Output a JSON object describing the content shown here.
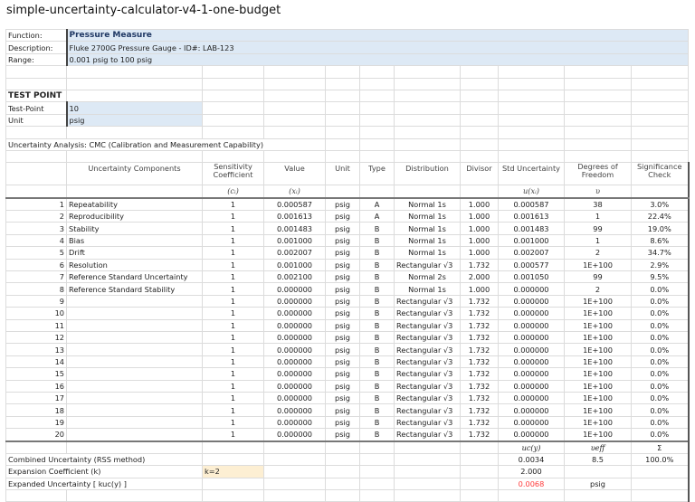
{
  "title": "simple-uncertainty-calculator-v4-1-one-budget",
  "info": {
    "function_label": "Function:",
    "function_value": "Pressure Measure",
    "description_label": "Description:",
    "description_value": "Fluke 2700G Pressure Gauge - ID#: LAB-123",
    "range_label": "Range:",
    "range_value": "0.001 psig to 100 psig"
  },
  "test_point": {
    "heading": "TEST POINT",
    "tp_label": "Test-Point",
    "tp_value": "10",
    "unit_label": "Unit",
    "unit_value": "psig"
  },
  "analysis_title": "Uncertainty Analysis: CMC (Calibration and Measurement Capability)",
  "headers": {
    "components": "Uncertainty Components",
    "sensitivity": "Sensitivity Coefficient",
    "sensitivity_sym": "(cᵢ)",
    "value": "Value",
    "value_sym": "(xᵢ)",
    "unit": "Unit",
    "type": "Type",
    "distribution": "Distribution",
    "divisor": "Divisor",
    "std": "Std Uncertainty",
    "std_sym": "u(xᵢ)",
    "dof": "Degrees of Freedom",
    "dof_sym": "υ",
    "sig": "Significance Check"
  },
  "rows": [
    [
      "1",
      "Repeatability",
      "1",
      "0.000587",
      "psig",
      "A",
      "Normal 1s",
      "1.000",
      "0.000587",
      "38",
      "3.0%"
    ],
    [
      "2",
      "Reproducibility",
      "1",
      "0.001613",
      "psig",
      "A",
      "Normal 1s",
      "1.000",
      "0.001613",
      "1",
      "22.4%"
    ],
    [
      "3",
      "Stability",
      "1",
      "0.001483",
      "psig",
      "B",
      "Normal 1s",
      "1.000",
      "0.001483",
      "99",
      "19.0%"
    ],
    [
      "4",
      "Bias",
      "1",
      "0.001000",
      "psig",
      "B",
      "Normal 1s",
      "1.000",
      "0.001000",
      "1",
      "8.6%"
    ],
    [
      "5",
      "Drift",
      "1",
      "0.002007",
      "psig",
      "B",
      "Normal 1s",
      "1.000",
      "0.002007",
      "2",
      "34.7%"
    ],
    [
      "6",
      "Resolution",
      "1",
      "0.001000",
      "psig",
      "B",
      "Rectangular √3",
      "1.732",
      "0.000577",
      "1E+100",
      "2.9%"
    ],
    [
      "7",
      "Reference Standard Uncertainty",
      "1",
      "0.002100",
      "psig",
      "B",
      "Normal 2s",
      "2.000",
      "0.001050",
      "99",
      "9.5%"
    ],
    [
      "8",
      "Reference Standard Stability",
      "1",
      "0.000000",
      "psig",
      "B",
      "Normal 1s",
      "1.000",
      "0.000000",
      "2",
      "0.0%"
    ],
    [
      "9",
      "",
      "1",
      "0.000000",
      "psig",
      "B",
      "Rectangular √3",
      "1.732",
      "0.000000",
      "1E+100",
      "0.0%"
    ],
    [
      "10",
      "",
      "1",
      "0.000000",
      "psig",
      "B",
      "Rectangular √3",
      "1.732",
      "0.000000",
      "1E+100",
      "0.0%"
    ],
    [
      "11",
      "",
      "1",
      "0.000000",
      "psig",
      "B",
      "Rectangular √3",
      "1.732",
      "0.000000",
      "1E+100",
      "0.0%"
    ],
    [
      "12",
      "",
      "1",
      "0.000000",
      "psig",
      "B",
      "Rectangular √3",
      "1.732",
      "0.000000",
      "1E+100",
      "0.0%"
    ],
    [
      "13",
      "",
      "1",
      "0.000000",
      "psig",
      "B",
      "Rectangular √3",
      "1.732",
      "0.000000",
      "1E+100",
      "0.0%"
    ],
    [
      "14",
      "",
      "1",
      "0.000000",
      "psig",
      "B",
      "Rectangular √3",
      "1.732",
      "0.000000",
      "1E+100",
      "0.0%"
    ],
    [
      "15",
      "",
      "1",
      "0.000000",
      "psig",
      "B",
      "Rectangular √3",
      "1.732",
      "0.000000",
      "1E+100",
      "0.0%"
    ],
    [
      "16",
      "",
      "1",
      "0.000000",
      "psig",
      "B",
      "Rectangular √3",
      "1.732",
      "0.000000",
      "1E+100",
      "0.0%"
    ],
    [
      "17",
      "",
      "1",
      "0.000000",
      "psig",
      "B",
      "Rectangular √3",
      "1.732",
      "0.000000",
      "1E+100",
      "0.0%"
    ],
    [
      "18",
      "",
      "1",
      "0.000000",
      "psig",
      "B",
      "Rectangular √3",
      "1.732",
      "0.000000",
      "1E+100",
      "0.0%"
    ],
    [
      "19",
      "",
      "1",
      "0.000000",
      "psig",
      "B",
      "Rectangular √3",
      "1.732",
      "0.000000",
      "1E+100",
      "0.0%"
    ],
    [
      "20",
      "",
      "1",
      "0.000000",
      "psig",
      "B",
      "Rectangular √3",
      "1.732",
      "0.000000",
      "1E+100",
      "0.0%"
    ]
  ],
  "summary": {
    "uc_sym": "uc(y)",
    "veff_sym": "υeff",
    "sigma_sym": "Σ",
    "combined_label": "Combined Uncertainty (RSS method)",
    "combined_value": "0.0034",
    "combined_veff": "8.5",
    "combined_sum": "100.0%",
    "k_label": "Expansion Coefficient (k)",
    "k_input": "k=2",
    "k_value": "2.000",
    "expanded_label": "Expanded Uncertainty [ kuc(y) ]",
    "expanded_value": "0.0068",
    "expanded_unit": "psig"
  },
  "colors": {
    "input_fill": "#dde9f5",
    "k_fill": "#fdefd3",
    "expanded_value": "#ff3b3b"
  }
}
